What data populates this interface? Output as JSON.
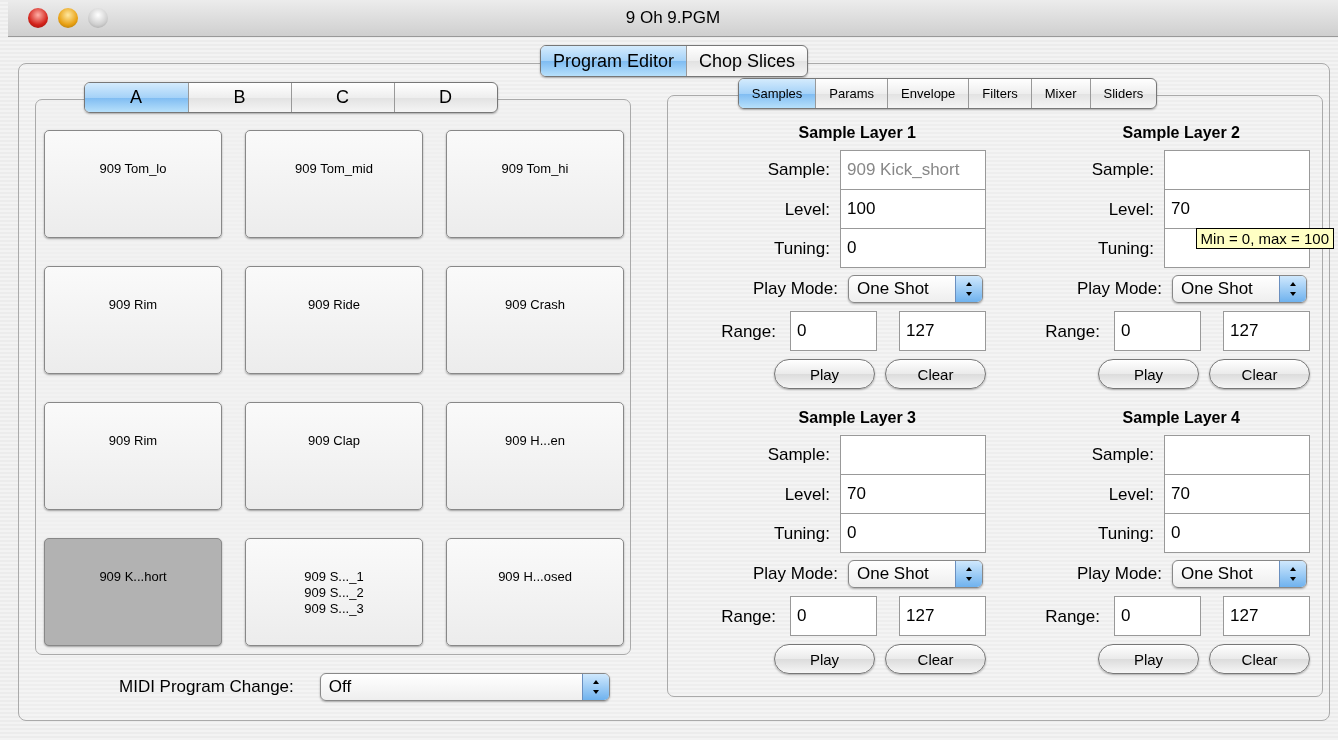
{
  "window": {
    "title": "9 Oh 9.PGM"
  },
  "tabs": [
    {
      "label": "Program Editor",
      "selected": true
    },
    {
      "label": "Chop Slices",
      "selected": false
    }
  ],
  "bank_tabs": [
    {
      "label": "A",
      "selected": true
    },
    {
      "label": "B",
      "selected": false
    },
    {
      "label": "C",
      "selected": false
    },
    {
      "label": "D",
      "selected": false
    }
  ],
  "pads": [
    {
      "lines": [
        "909 Tom_lo"
      ],
      "selected": false
    },
    {
      "lines": [
        "909 Tom_mid"
      ],
      "selected": false
    },
    {
      "lines": [
        "909 Tom_hi"
      ],
      "selected": false
    },
    {
      "lines": [
        "909 Rim"
      ],
      "selected": false
    },
    {
      "lines": [
        "909 Ride"
      ],
      "selected": false
    },
    {
      "lines": [
        "909 Crash"
      ],
      "selected": false
    },
    {
      "lines": [
        "909 Rim"
      ],
      "selected": false
    },
    {
      "lines": [
        "909 Clap"
      ],
      "selected": false
    },
    {
      "lines": [
        "909 H...en"
      ],
      "selected": false
    },
    {
      "lines": [
        "909 K...hort"
      ],
      "selected": true
    },
    {
      "lines": [
        "909 S..._1",
        "909 S..._2",
        "909 S..._3"
      ],
      "selected": false
    },
    {
      "lines": [
        "909 H...osed"
      ],
      "selected": false
    }
  ],
  "midi_program_change": {
    "label": "MIDI Program Change:",
    "value": "Off"
  },
  "sub_tabs": [
    {
      "label": "Samples",
      "selected": true
    },
    {
      "label": "Params",
      "selected": false
    },
    {
      "label": "Envelope",
      "selected": false
    },
    {
      "label": "Filters",
      "selected": false
    },
    {
      "label": "Mixer",
      "selected": false
    },
    {
      "label": "Sliders",
      "selected": false
    }
  ],
  "layers": [
    {
      "title": "Sample Layer 1",
      "fields": [
        {
          "kind": "text",
          "label": "Sample:",
          "placeholder": "909 Kick_short"
        },
        {
          "kind": "text",
          "label": "Level:",
          "value": "100"
        },
        {
          "kind": "text",
          "label": "Tuning:",
          "value": "0"
        },
        {
          "kind": "popup",
          "label": "Play Mode:",
          "value": "One Shot"
        },
        {
          "kind": "range",
          "label": "Range:",
          "low": "0",
          "high": "127"
        }
      ],
      "buttons": [
        "Play",
        "Clear"
      ]
    },
    {
      "title": "Sample Layer 2",
      "fields": [
        {
          "kind": "text",
          "label": "Sample:"
        },
        {
          "kind": "text",
          "label": "Level:",
          "value": "70",
          "tooltip": "Min = 0, max = 100"
        },
        {
          "kind": "text",
          "label": "Tuning:"
        },
        {
          "kind": "popup",
          "label": "Play Mode:",
          "value": "One Shot"
        },
        {
          "kind": "range",
          "label": "Range:",
          "low": "0",
          "high": "127"
        }
      ],
      "buttons": [
        "Play",
        "Clear"
      ]
    },
    {
      "title": "Sample Layer 3",
      "fields": [
        {
          "kind": "text",
          "label": "Sample:"
        },
        {
          "kind": "text",
          "label": "Level:",
          "value": "70"
        },
        {
          "kind": "text",
          "label": "Tuning:",
          "value": "0"
        },
        {
          "kind": "popup",
          "label": "Play Mode:",
          "value": "One Shot"
        },
        {
          "kind": "range",
          "label": "Range:",
          "low": "0",
          "high": "127"
        }
      ],
      "buttons": [
        "Play",
        "Clear"
      ]
    },
    {
      "title": "Sample Layer 4",
      "fields": [
        {
          "kind": "text",
          "label": "Sample:"
        },
        {
          "kind": "text",
          "label": "Level:",
          "value": "70"
        },
        {
          "kind": "text",
          "label": "Tuning:",
          "value": "0"
        },
        {
          "kind": "popup",
          "label": "Play Mode:",
          "value": "One Shot"
        },
        {
          "kind": "range",
          "label": "Range:",
          "low": "0",
          "high": "127"
        }
      ],
      "buttons": [
        "Play",
        "Clear"
      ]
    }
  ]
}
